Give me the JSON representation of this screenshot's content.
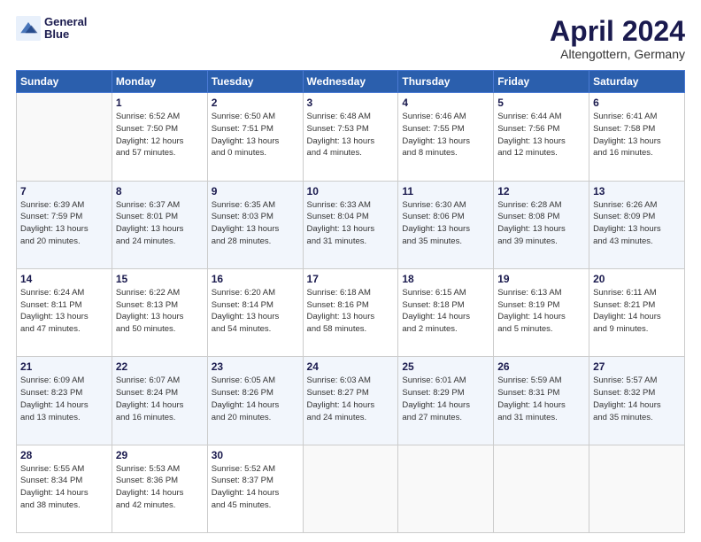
{
  "header": {
    "logo_line1": "General",
    "logo_line2": "Blue",
    "title": "April 2024",
    "subtitle": "Altengottern, Germany"
  },
  "weekdays": [
    "Sunday",
    "Monday",
    "Tuesday",
    "Wednesday",
    "Thursday",
    "Friday",
    "Saturday"
  ],
  "weeks": [
    [
      {
        "day": "",
        "info": ""
      },
      {
        "day": "1",
        "info": "Sunrise: 6:52 AM\nSunset: 7:50 PM\nDaylight: 12 hours\nand 57 minutes."
      },
      {
        "day": "2",
        "info": "Sunrise: 6:50 AM\nSunset: 7:51 PM\nDaylight: 13 hours\nand 0 minutes."
      },
      {
        "day": "3",
        "info": "Sunrise: 6:48 AM\nSunset: 7:53 PM\nDaylight: 13 hours\nand 4 minutes."
      },
      {
        "day": "4",
        "info": "Sunrise: 6:46 AM\nSunset: 7:55 PM\nDaylight: 13 hours\nand 8 minutes."
      },
      {
        "day": "5",
        "info": "Sunrise: 6:44 AM\nSunset: 7:56 PM\nDaylight: 13 hours\nand 12 minutes."
      },
      {
        "day": "6",
        "info": "Sunrise: 6:41 AM\nSunset: 7:58 PM\nDaylight: 13 hours\nand 16 minutes."
      }
    ],
    [
      {
        "day": "7",
        "info": "Sunrise: 6:39 AM\nSunset: 7:59 PM\nDaylight: 13 hours\nand 20 minutes."
      },
      {
        "day": "8",
        "info": "Sunrise: 6:37 AM\nSunset: 8:01 PM\nDaylight: 13 hours\nand 24 minutes."
      },
      {
        "day": "9",
        "info": "Sunrise: 6:35 AM\nSunset: 8:03 PM\nDaylight: 13 hours\nand 28 minutes."
      },
      {
        "day": "10",
        "info": "Sunrise: 6:33 AM\nSunset: 8:04 PM\nDaylight: 13 hours\nand 31 minutes."
      },
      {
        "day": "11",
        "info": "Sunrise: 6:30 AM\nSunset: 8:06 PM\nDaylight: 13 hours\nand 35 minutes."
      },
      {
        "day": "12",
        "info": "Sunrise: 6:28 AM\nSunset: 8:08 PM\nDaylight: 13 hours\nand 39 minutes."
      },
      {
        "day": "13",
        "info": "Sunrise: 6:26 AM\nSunset: 8:09 PM\nDaylight: 13 hours\nand 43 minutes."
      }
    ],
    [
      {
        "day": "14",
        "info": "Sunrise: 6:24 AM\nSunset: 8:11 PM\nDaylight: 13 hours\nand 47 minutes."
      },
      {
        "day": "15",
        "info": "Sunrise: 6:22 AM\nSunset: 8:13 PM\nDaylight: 13 hours\nand 50 minutes."
      },
      {
        "day": "16",
        "info": "Sunrise: 6:20 AM\nSunset: 8:14 PM\nDaylight: 13 hours\nand 54 minutes."
      },
      {
        "day": "17",
        "info": "Sunrise: 6:18 AM\nSunset: 8:16 PM\nDaylight: 13 hours\nand 58 minutes."
      },
      {
        "day": "18",
        "info": "Sunrise: 6:15 AM\nSunset: 8:18 PM\nDaylight: 14 hours\nand 2 minutes."
      },
      {
        "day": "19",
        "info": "Sunrise: 6:13 AM\nSunset: 8:19 PM\nDaylight: 14 hours\nand 5 minutes."
      },
      {
        "day": "20",
        "info": "Sunrise: 6:11 AM\nSunset: 8:21 PM\nDaylight: 14 hours\nand 9 minutes."
      }
    ],
    [
      {
        "day": "21",
        "info": "Sunrise: 6:09 AM\nSunset: 8:23 PM\nDaylight: 14 hours\nand 13 minutes."
      },
      {
        "day": "22",
        "info": "Sunrise: 6:07 AM\nSunset: 8:24 PM\nDaylight: 14 hours\nand 16 minutes."
      },
      {
        "day": "23",
        "info": "Sunrise: 6:05 AM\nSunset: 8:26 PM\nDaylight: 14 hours\nand 20 minutes."
      },
      {
        "day": "24",
        "info": "Sunrise: 6:03 AM\nSunset: 8:27 PM\nDaylight: 14 hours\nand 24 minutes."
      },
      {
        "day": "25",
        "info": "Sunrise: 6:01 AM\nSunset: 8:29 PM\nDaylight: 14 hours\nand 27 minutes."
      },
      {
        "day": "26",
        "info": "Sunrise: 5:59 AM\nSunset: 8:31 PM\nDaylight: 14 hours\nand 31 minutes."
      },
      {
        "day": "27",
        "info": "Sunrise: 5:57 AM\nSunset: 8:32 PM\nDaylight: 14 hours\nand 35 minutes."
      }
    ],
    [
      {
        "day": "28",
        "info": "Sunrise: 5:55 AM\nSunset: 8:34 PM\nDaylight: 14 hours\nand 38 minutes."
      },
      {
        "day": "29",
        "info": "Sunrise: 5:53 AM\nSunset: 8:36 PM\nDaylight: 14 hours\nand 42 minutes."
      },
      {
        "day": "30",
        "info": "Sunrise: 5:52 AM\nSunset: 8:37 PM\nDaylight: 14 hours\nand 45 minutes."
      },
      {
        "day": "",
        "info": ""
      },
      {
        "day": "",
        "info": ""
      },
      {
        "day": "",
        "info": ""
      },
      {
        "day": "",
        "info": ""
      }
    ]
  ]
}
